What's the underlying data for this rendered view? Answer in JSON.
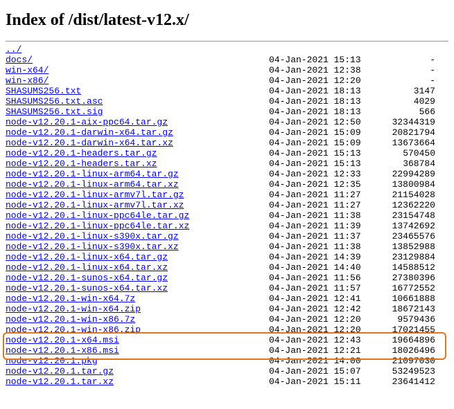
{
  "title": "Index of /dist/latest-v12.x/",
  "parent": "../",
  "entries": [
    {
      "name": "docs/",
      "date": "04-Jan-2021 15:13",
      "size": "-"
    },
    {
      "name": "win-x64/",
      "date": "04-Jan-2021 12:38",
      "size": "-"
    },
    {
      "name": "win-x86/",
      "date": "04-Jan-2021 12:20",
      "size": "-"
    },
    {
      "name": "SHASUMS256.txt",
      "date": "04-Jan-2021 18:13",
      "size": "3147"
    },
    {
      "name": "SHASUMS256.txt.asc",
      "date": "04-Jan-2021 18:13",
      "size": "4029"
    },
    {
      "name": "SHASUMS256.txt.sig",
      "date": "04-Jan-2021 18:13",
      "size": "566"
    },
    {
      "name": "node-v12.20.1-aix-ppc64.tar.gz",
      "date": "04-Jan-2021 12:50",
      "size": "32344319"
    },
    {
      "name": "node-v12.20.1-darwin-x64.tar.gz",
      "date": "04-Jan-2021 15:09",
      "size": "20821794"
    },
    {
      "name": "node-v12.20.1-darwin-x64.tar.xz",
      "date": "04-Jan-2021 15:09",
      "size": "13673664"
    },
    {
      "name": "node-v12.20.1-headers.tar.gz",
      "date": "04-Jan-2021 15:13",
      "size": "570450"
    },
    {
      "name": "node-v12.20.1-headers.tar.xz",
      "date": "04-Jan-2021 15:13",
      "size": "368784"
    },
    {
      "name": "node-v12.20.1-linux-arm64.tar.gz",
      "date": "04-Jan-2021 12:33",
      "size": "22994289"
    },
    {
      "name": "node-v12.20.1-linux-arm64.tar.xz",
      "date": "04-Jan-2021 12:35",
      "size": "13800984"
    },
    {
      "name": "node-v12.20.1-linux-armv7l.tar.gz",
      "date": "04-Jan-2021 11:27",
      "size": "21154028"
    },
    {
      "name": "node-v12.20.1-linux-armv7l.tar.xz",
      "date": "04-Jan-2021 11:27",
      "size": "12362220"
    },
    {
      "name": "node-v12.20.1-linux-ppc64le.tar.gz",
      "date": "04-Jan-2021 11:38",
      "size": "23154748"
    },
    {
      "name": "node-v12.20.1-linux-ppc64le.tar.xz",
      "date": "04-Jan-2021 11:39",
      "size": "13742692"
    },
    {
      "name": "node-v12.20.1-linux-s390x.tar.gz",
      "date": "04-Jan-2021 11:37",
      "size": "23465576"
    },
    {
      "name": "node-v12.20.1-linux-s390x.tar.xz",
      "date": "04-Jan-2021 11:38",
      "size": "13852988"
    },
    {
      "name": "node-v12.20.1-linux-x64.tar.gz",
      "date": "04-Jan-2021 14:39",
      "size": "23129884"
    },
    {
      "name": "node-v12.20.1-linux-x64.tar.xz",
      "date": "04-Jan-2021 14:40",
      "size": "14588512"
    },
    {
      "name": "node-v12.20.1-sunos-x64.tar.gz",
      "date": "04-Jan-2021 11:56",
      "size": "27380396"
    },
    {
      "name": "node-v12.20.1-sunos-x64.tar.xz",
      "date": "04-Jan-2021 11:57",
      "size": "16772552"
    },
    {
      "name": "node-v12.20.1-win-x64.7z",
      "date": "04-Jan-2021 12:41",
      "size": "10661888"
    },
    {
      "name": "node-v12.20.1-win-x64.zip",
      "date": "04-Jan-2021 12:42",
      "size": "18672143"
    },
    {
      "name": "node-v12.20.1-win-x86.7z",
      "date": "04-Jan-2021 12:20",
      "size": "9579436"
    },
    {
      "name": "node-v12.20.1-win-x86.zip",
      "date": "04-Jan-2021 12:20",
      "size": "17021455"
    },
    {
      "name": "node-v12.20.1-x64.msi",
      "date": "04-Jan-2021 12:43",
      "size": "19664896"
    },
    {
      "name": "node-v12.20.1-x86.msi",
      "date": "04-Jan-2021 12:21",
      "size": "18026496"
    },
    {
      "name": "node-v12.20.1.pkg",
      "date": "04-Jan-2021 14:00",
      "size": "21097030"
    },
    {
      "name": "node-v12.20.1.tar.gz",
      "date": "04-Jan-2021 15:07",
      "size": "53249523"
    },
    {
      "name": "node-v12.20.1.tar.xz",
      "date": "04-Jan-2021 15:11",
      "size": "23641412"
    }
  ],
  "highlight": {
    "startIndex": 27,
    "endIndex": 28
  }
}
